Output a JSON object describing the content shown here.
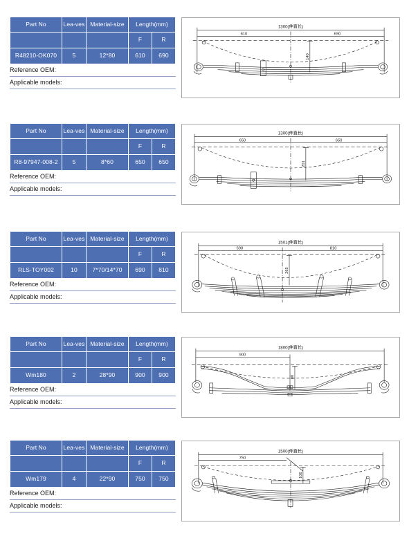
{
  "table_headers": {
    "part_no": "Part No",
    "leaves": "Lea-ves",
    "material_size": "Material-size",
    "length": "Length(mm)",
    "front": "F",
    "rear": "R"
  },
  "footer_labels": {
    "reference_oem": "Reference OEM:",
    "applicable_models": "Applicable models:"
  },
  "colors": {
    "header_blue": "#4f6fb3",
    "cell_text": "#ffffff",
    "rule": "#8da0c4",
    "panel_border": "#a8a8a8",
    "line": "#1a1a1a"
  },
  "products": [
    {
      "part_no": "R48210-OK070",
      "leaves": "5",
      "material_size": "12*80",
      "length_f": "610",
      "length_r": "690",
      "diagram": {
        "total_label": "1300(伸直长)",
        "left_label": "610",
        "right_label": "690",
        "height_label": "140",
        "style": "flat-multi-leaf",
        "leaf_count": 5,
        "clips": 2
      }
    },
    {
      "part_no": "R8-97947-008-2",
      "leaves": "5",
      "material_size": "8*60",
      "length_f": "650",
      "length_r": "650",
      "diagram": {
        "total_label": "1300(伸直长)",
        "left_label": "650",
        "right_label": "650",
        "height_label": "201",
        "style": "flat-multi-leaf",
        "leaf_count": 5,
        "clips": 2
      }
    },
    {
      "part_no": "RLS-TOY002",
      "leaves": "10",
      "material_size": "7*70/14*70",
      "length_f": "690",
      "length_r": "810",
      "diagram": {
        "total_label": "1501(伸直长)",
        "left_label": "690",
        "right_label": "810",
        "height_label": "265",
        "style": "stacked-tapered",
        "leaf_count": 10,
        "clips": 4
      }
    },
    {
      "part_no": "Wm180",
      "leaves": "2",
      "material_size": "28*90",
      "length_f": "900",
      "length_r": "900",
      "diagram": {
        "total_label": "1800(伸直长)",
        "left_label": "900",
        "right_label": "",
        "height_label": "80",
        "style": "parabolic-two-leaf",
        "leaf_count": 2,
        "clips": 2
      }
    },
    {
      "part_no": "Wm179",
      "leaves": "4",
      "material_size": "22*90",
      "length_f": "750",
      "length_r": "750",
      "diagram": {
        "total_label": "1500(伸直长)",
        "left_label": "750",
        "right_label": "",
        "height_label": "106",
        "style": "stacked-tapered",
        "leaf_count": 4,
        "clips": 2
      }
    }
  ]
}
